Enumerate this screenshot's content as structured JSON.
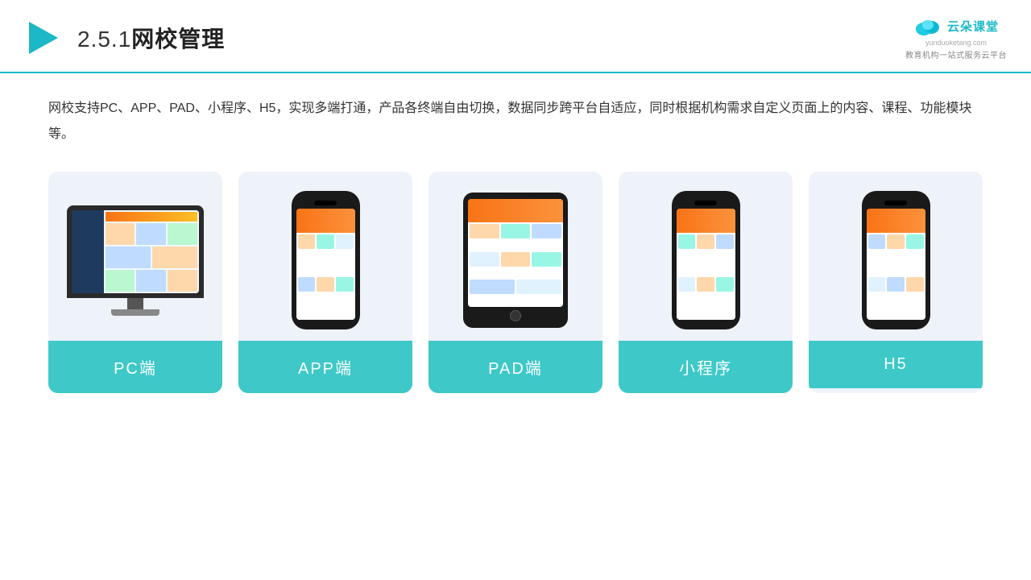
{
  "header": {
    "title_prefix": "2.5.1",
    "title_main": "网校管理",
    "logo_main": "云朵课堂",
    "logo_url": "yunduoketang.com",
    "logo_tagline": "教育机构一站\n式服务云平台"
  },
  "description": "网校支持PC、APP、PAD、小程序、H5，实现多端打通，产品各终端自由切换，数据同步跨平台自适应，同时根据机构需求自定义页面上的内容、课程、功能模块等。",
  "cards": [
    {
      "id": "pc",
      "label": "PC端"
    },
    {
      "id": "app",
      "label": "APP端"
    },
    {
      "id": "pad",
      "label": "PAD端"
    },
    {
      "id": "miniprogram",
      "label": "小程序"
    },
    {
      "id": "h5",
      "label": "H5"
    }
  ],
  "accent_color": "#3ec8c8",
  "border_color": "#1cb8c8"
}
